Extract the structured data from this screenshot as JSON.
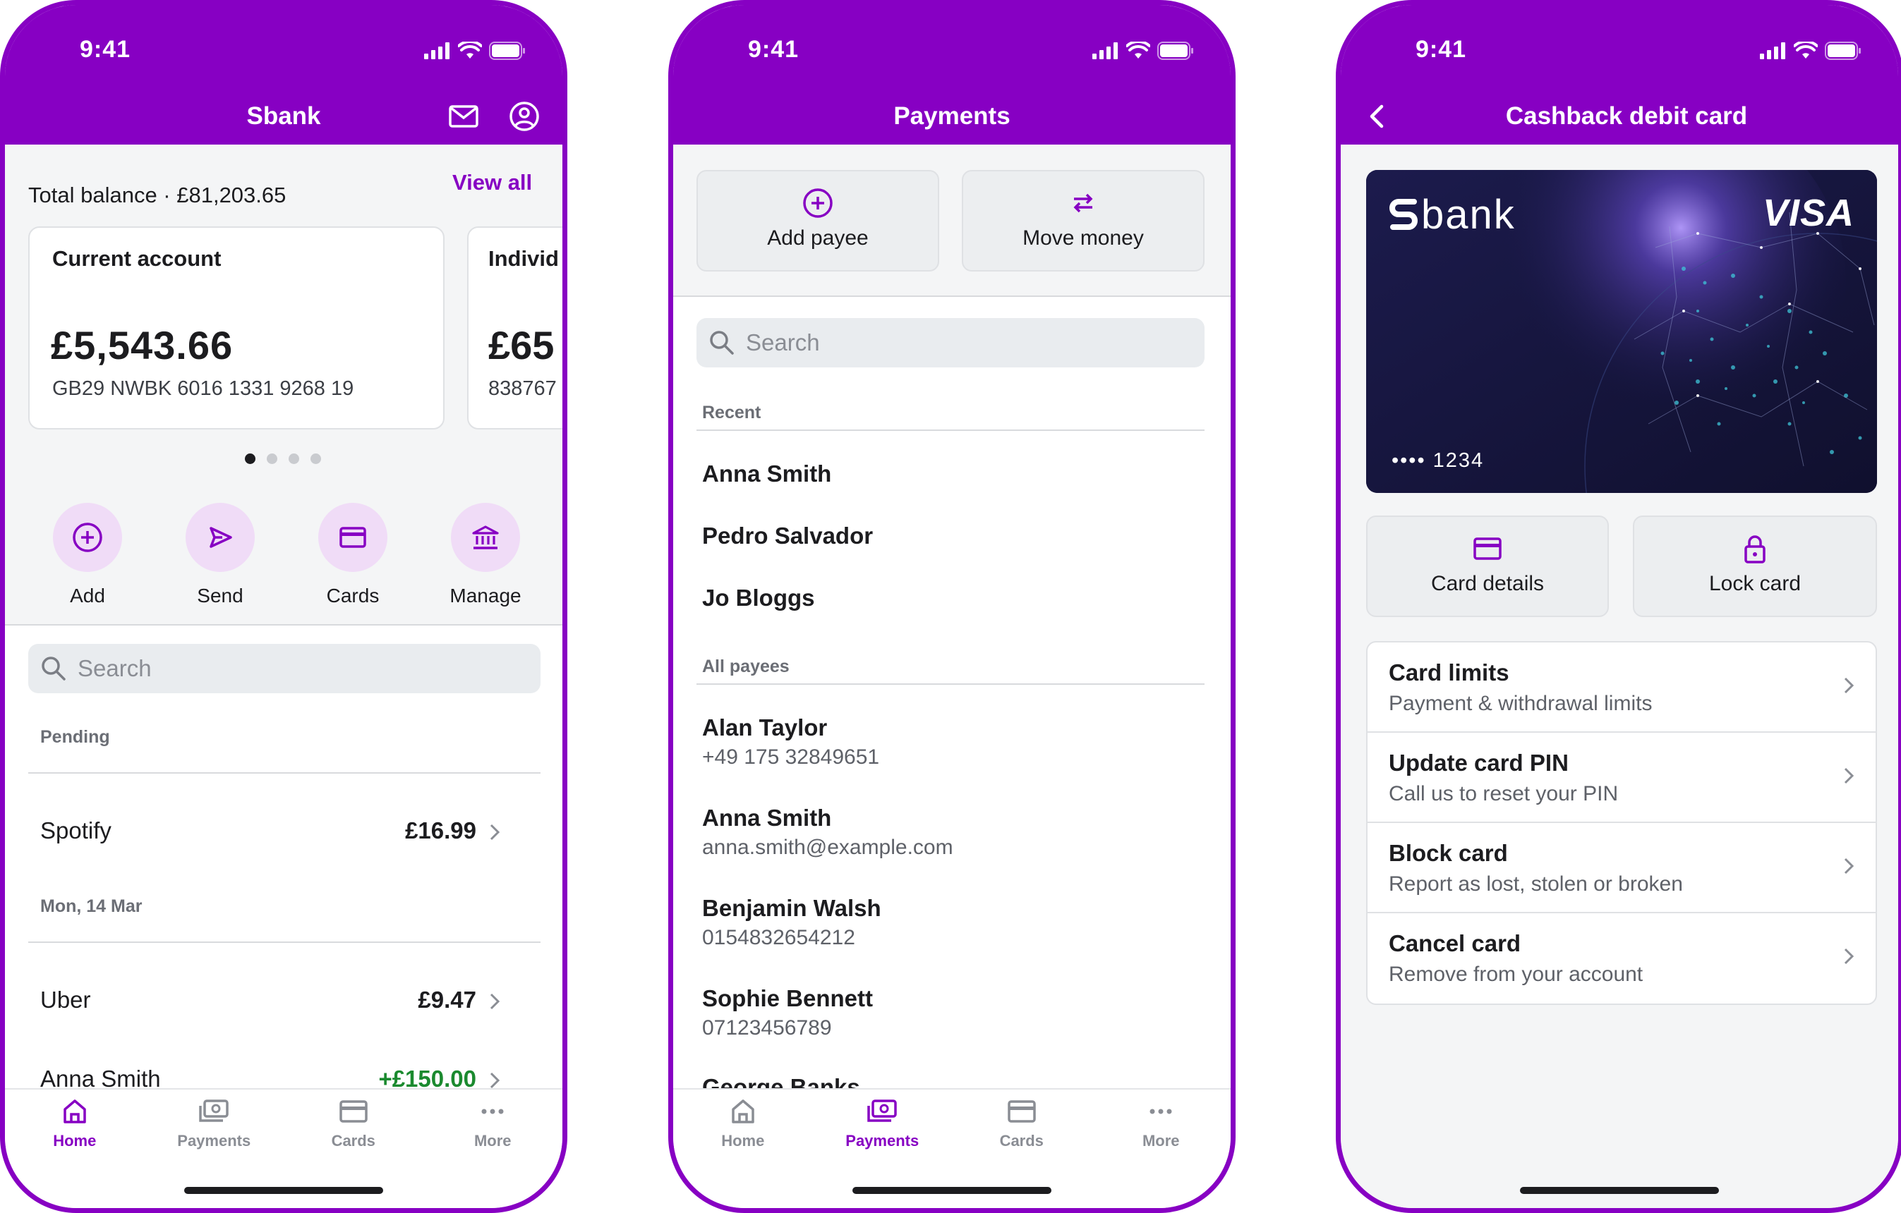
{
  "status": {
    "time": "9:41"
  },
  "colors": {
    "brand": "#8700c3",
    "positive": "#1b8a2f"
  },
  "home": {
    "title": "Sbank",
    "total_balance": "Total balance · £81,203.65",
    "view_all": "View all",
    "accounts": [
      {
        "name": "Current account",
        "balance": "£5,543.66",
        "iban": "GB29 NWBK 6016 1331 9268 19"
      },
      {
        "name": "Individ",
        "balance": "£65",
        "iban": "838767"
      }
    ],
    "pager": {
      "count": 4,
      "active": 1
    },
    "quick_actions": [
      {
        "label": "Add",
        "icon": "plus-circle-icon"
      },
      {
        "label": "Send",
        "icon": "send-icon"
      },
      {
        "label": "Cards",
        "icon": "card-icon"
      },
      {
        "label": "Manage",
        "icon": "bank-icon"
      }
    ],
    "search_placeholder": "Search",
    "sections": [
      {
        "label": "Pending",
        "items": [
          {
            "merchant": "Spotify",
            "amount": "£16.99"
          }
        ]
      },
      {
        "label": "Mon, 14 Mar",
        "items": [
          {
            "merchant": "Uber",
            "amount": "£9.47"
          },
          {
            "merchant": "Anna Smith",
            "amount": "+£150.00"
          }
        ]
      }
    ]
  },
  "payments": {
    "title": "Payments",
    "add_payee": "Add payee",
    "move_money": "Move money",
    "search_placeholder": "Search",
    "recent_label": "Recent",
    "recent": [
      "Anna Smith",
      "Pedro Salvador",
      "Jo Bloggs"
    ],
    "all_label": "All payees",
    "all": [
      {
        "name": "Alan Taylor",
        "detail": "+49 175 32849651"
      },
      {
        "name": "Anna Smith",
        "detail": "anna.smith@example.com"
      },
      {
        "name": "Benjamin Walsh",
        "detail": "0154832654212"
      },
      {
        "name": "Sophie Bennett",
        "detail": "07123456789"
      },
      {
        "name": "George Banks",
        "detail": ""
      }
    ]
  },
  "card": {
    "title": "Cashback debit card",
    "brand_name": "bank",
    "network": "VISA",
    "last4": "•••• 1234",
    "card_details": "Card details",
    "lock_card": "Lock card",
    "options": [
      {
        "title": "Card limits",
        "subtitle": "Payment & withdrawal limits"
      },
      {
        "title": "Update card PIN",
        "subtitle": "Call us to reset your PIN"
      },
      {
        "title": "Block card",
        "subtitle": "Report as lost, stolen or broken"
      },
      {
        "title": "Cancel card",
        "subtitle": "Remove from your account"
      }
    ]
  },
  "tabs": [
    "Home",
    "Payments",
    "Cards",
    "More"
  ]
}
